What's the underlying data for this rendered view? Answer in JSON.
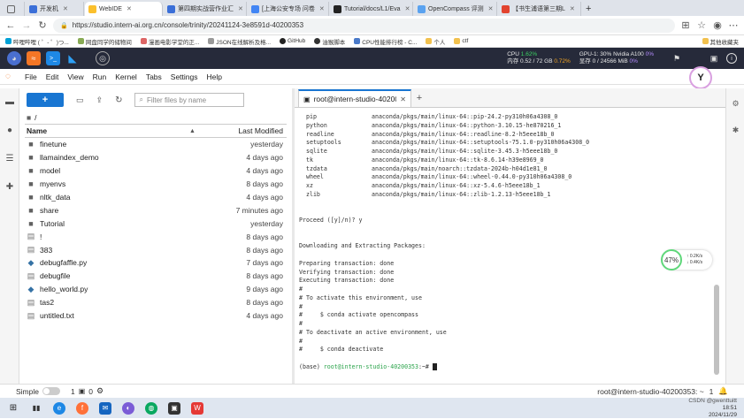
{
  "browser": {
    "tabs": [
      {
        "label": "开发机",
        "color": "#3b6fd8",
        "active": false
      },
      {
        "label": "WebIDE",
        "color": "#ffffff",
        "active": true
      },
      {
        "label": "第四期实战营作业汇",
        "color": "#3b6fd8",
        "active": false
      },
      {
        "label": "[上海公安专场 问卷",
        "color": "#4285f4",
        "active": false
      },
      {
        "label": "Tutorial/docs/L1/Eva",
        "color": "#222222",
        "active": false
      },
      {
        "label": "OpenCompass 评测",
        "color": "#5aa2f0",
        "active": false
      },
      {
        "label": "【书生浦语第三期L",
        "color": "#e2432f",
        "active": false
      }
    ],
    "new_tab_symbol": "+",
    "url": "https://studio.intern-ai.org.cn/console/trinity/20241124-3e8591d-40200353",
    "bookmarks": [
      "哔哩哔哩 ( ゜- ゜)つ...",
      "网盘同学的储物间",
      "漫画电影学堂的正...",
      "JSON在线解析及格...",
      "GitHub",
      "油猴脚本",
      "CPU性能排行榜 - C...",
      "个人",
      "ctf"
    ],
    "bookmarks_right": "其他收藏夹"
  },
  "ide_bar": {
    "metrics": [
      {
        "label": "CPU",
        "value": "1.62%"
      },
      {
        "label": "GPU-1: 30% Nvidia A100",
        "value": "0%"
      },
      {
        "label": "内存 0.52 / 72 GB",
        "value": "0.72%"
      },
      {
        "label": "显存 0 / 24566 MiB",
        "value": "0%"
      }
    ]
  },
  "avatar_text": "Y",
  "menu": [
    "File",
    "Edit",
    "View",
    "Run",
    "Kernel",
    "Tabs",
    "Settings",
    "Help"
  ],
  "file_browser": {
    "new_label": "+",
    "filter_placeholder": "Filter files by name",
    "breadcrumb": "/",
    "col_name": "Name",
    "col_modified": "Last Modified",
    "files": [
      {
        "name": "finetune",
        "type": "folder",
        "modified": "yesterday"
      },
      {
        "name": "llamaindex_demo",
        "type": "folder",
        "modified": "4 days ago"
      },
      {
        "name": "model",
        "type": "folder",
        "modified": "4 days ago"
      },
      {
        "name": "myenvs",
        "type": "folder",
        "modified": "8 days ago"
      },
      {
        "name": "nltk_data",
        "type": "folder",
        "modified": "4 days ago"
      },
      {
        "name": "share",
        "type": "folder",
        "modified": "7 minutes ago"
      },
      {
        "name": "Tutorial",
        "type": "folder",
        "modified": "yesterday"
      },
      {
        "name": "!",
        "type": "file",
        "modified": "8 days ago"
      },
      {
        "name": "383",
        "type": "file",
        "modified": "8 days ago"
      },
      {
        "name": "debugfaffle.py",
        "type": "py",
        "modified": "7 days ago"
      },
      {
        "name": "debugfile",
        "type": "file",
        "modified": "8 days ago"
      },
      {
        "name": "hello_world.py",
        "type": "py",
        "modified": "9 days ago"
      },
      {
        "name": "tas2",
        "type": "file",
        "modified": "8 days ago"
      },
      {
        "name": "untitled.txt",
        "type": "file",
        "modified": "4 days ago"
      }
    ]
  },
  "terminal": {
    "tab_title": "root@intern-studio-40200",
    "packages": [
      {
        "name": "pip",
        "src": "anaconda/pkgs/main/linux-64::pip-24.2-py310h06a4308_0"
      },
      {
        "name": "python",
        "src": "anaconda/pkgs/main/linux-64::python-3.10.15-he870216_1"
      },
      {
        "name": "readline",
        "src": "anaconda/pkgs/main/linux-64::readline-8.2-h5eee18b_0"
      },
      {
        "name": "setuptools",
        "src": "anaconda/pkgs/main/linux-64::setuptools-75.1.0-py310h06a4308_0"
      },
      {
        "name": "sqlite",
        "src": "anaconda/pkgs/main/linux-64::sqlite-3.45.3-h5eee18b_0"
      },
      {
        "name": "tk",
        "src": "anaconda/pkgs/main/linux-64::tk-8.6.14-h39e8969_0"
      },
      {
        "name": "tzdata",
        "src": "anaconda/pkgs/main/noarch::tzdata-2024b-h04d1e81_0"
      },
      {
        "name": "wheel",
        "src": "anaconda/pkgs/main/linux-64::wheel-0.44.0-py310h06a4308_0"
      },
      {
        "name": "xz",
        "src": "anaconda/pkgs/main/linux-64::xz-5.4.6-h5eee18b_1"
      },
      {
        "name": "zlib",
        "src": "anaconda/pkgs/main/linux-64::zlib-1.2.13-h5eee18b_1"
      }
    ],
    "proceed": "Proceed ([y]/n)? y",
    "downloading": "Downloading and Extracting Packages:",
    "prep": [
      "Preparing transaction: done",
      "Verifying transaction: done",
      "Executing transaction: done"
    ],
    "activate_lines": [
      "#",
      "# To activate this environment, use",
      "#",
      "#     $ conda activate opencompass",
      "#",
      "# To deactivate an active environment, use",
      "#",
      "#     $ conda deactivate"
    ],
    "prompt_env": "(base) ",
    "prompt_user": "root@intern-studio-40200353",
    "prompt_tail": ":~# "
  },
  "net_widget": {
    "percent": "47%",
    "up": "0.2K/s",
    "down": "0.4K/s"
  },
  "status_bar": {
    "mode": "Simple",
    "count1": "1",
    "count2": "0",
    "right": "root@intern-studio-40200353: ~",
    "right_num": "1"
  },
  "taskbar": {
    "time": "18:51",
    "date": "2024/11/29",
    "watermark": "CSDN @gwenttuitt"
  },
  "colors": {
    "accent": "#1976d2",
    "folder": "#616161",
    "python": "#3572a5",
    "prompt_green": "#2aa34a"
  }
}
